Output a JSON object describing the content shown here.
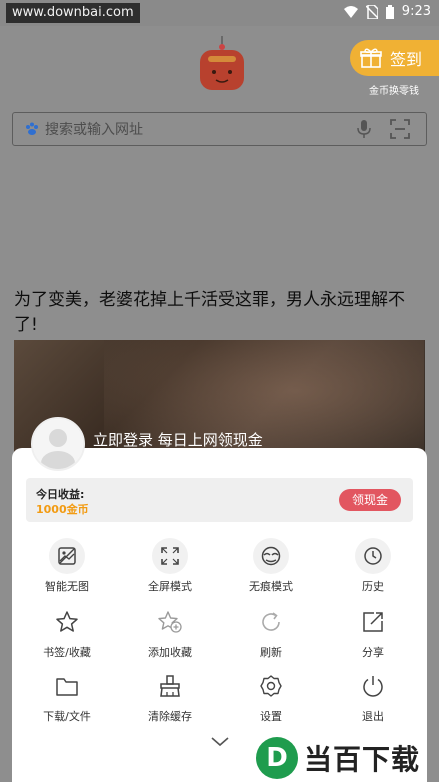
{
  "status_bar": {
    "watermark": "www.downbai.com",
    "time": "9:23"
  },
  "top": {
    "sign_in": "签到",
    "coin_exchange": "金币换零钱"
  },
  "search": {
    "placeholder": "搜索或输入网址"
  },
  "feed": {
    "headline": "为了变美，老婆花掉上千活受这罪，男人永远理解不了!"
  },
  "sheet": {
    "login_prompt": "立即登录 每日上网领现金",
    "earnings_label": "今日收益:",
    "earnings_value": "1000金币",
    "withdraw": "领现金",
    "menu": [
      {
        "label": "智能无图",
        "icon": "no-image-icon"
      },
      {
        "label": "全屏模式",
        "icon": "fullscreen-icon"
      },
      {
        "label": "无痕模式",
        "icon": "incognito-icon"
      },
      {
        "label": "历史",
        "icon": "history-icon"
      },
      {
        "label": "书签/收藏",
        "icon": "star-icon"
      },
      {
        "label": "添加收藏",
        "icon": "add-favorite-icon"
      },
      {
        "label": "刷新",
        "icon": "refresh-icon"
      },
      {
        "label": "分享",
        "icon": "share-icon"
      },
      {
        "label": "下载/文件",
        "icon": "folder-icon"
      },
      {
        "label": "清除缓存",
        "icon": "clear-cache-icon"
      },
      {
        "label": "设置",
        "icon": "settings-icon"
      },
      {
        "label": "退出",
        "icon": "power-icon"
      }
    ]
  },
  "watermark_brand": {
    "logo_letter": "D",
    "text": "当百下载"
  },
  "colors": {
    "accent_orange": "#f0b134",
    "withdraw_red": "#e25660",
    "earnings_orange": "#f29b12",
    "brand_green": "#1f9c4e"
  }
}
